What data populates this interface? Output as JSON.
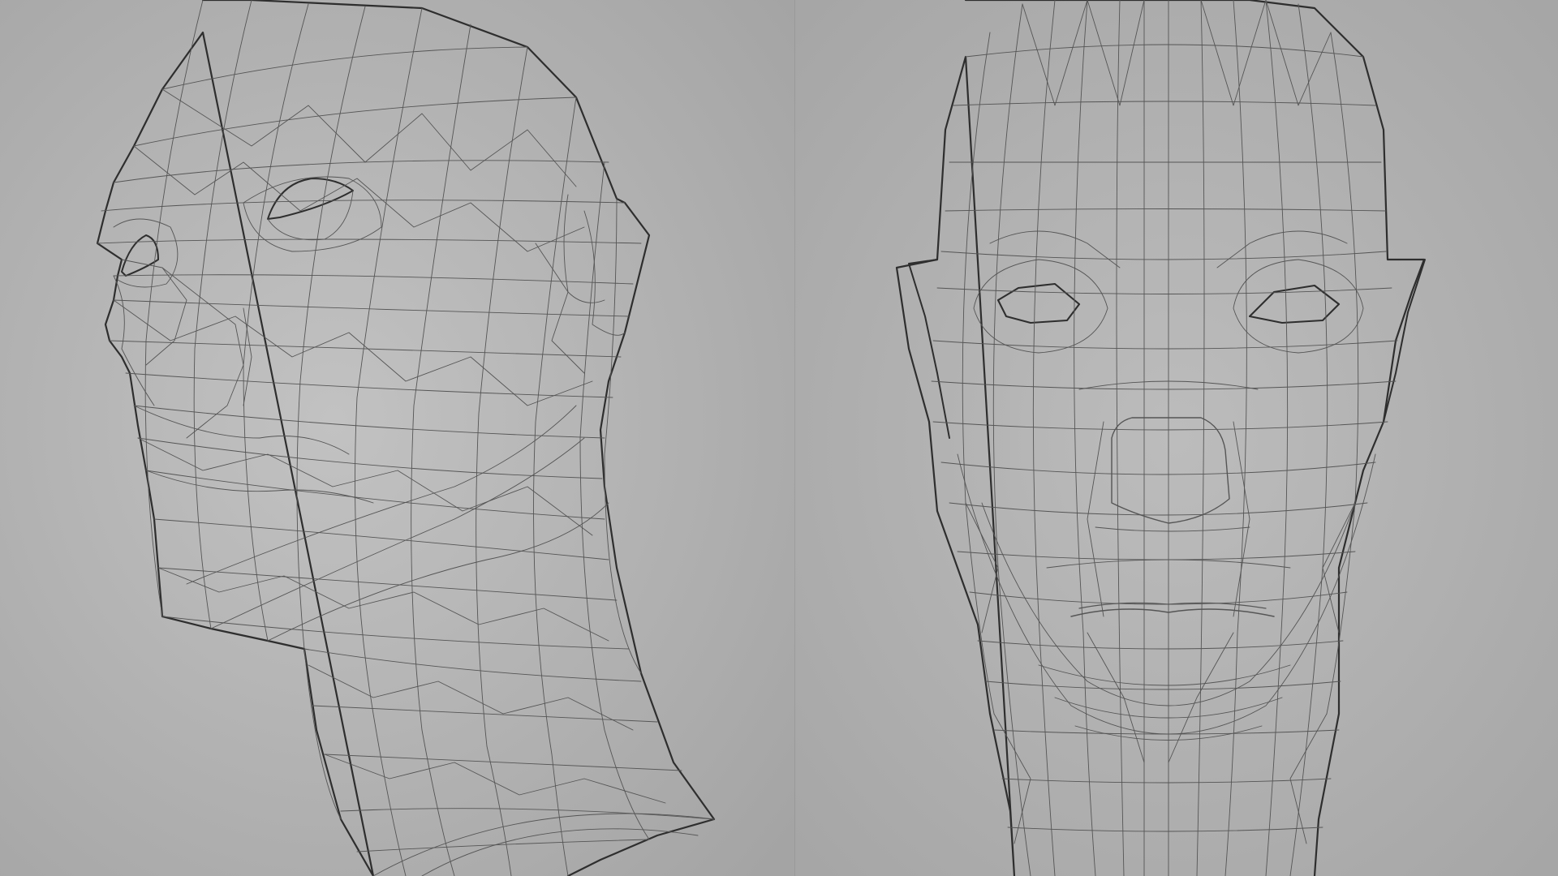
{
  "scene": {
    "background_color": "#a9a9a9",
    "wire_color": "#555555",
    "outline_color": "#2e2e2e",
    "views": [
      {
        "name": "head-three-quarter-view"
      },
      {
        "name": "head-front-view"
      }
    ]
  }
}
